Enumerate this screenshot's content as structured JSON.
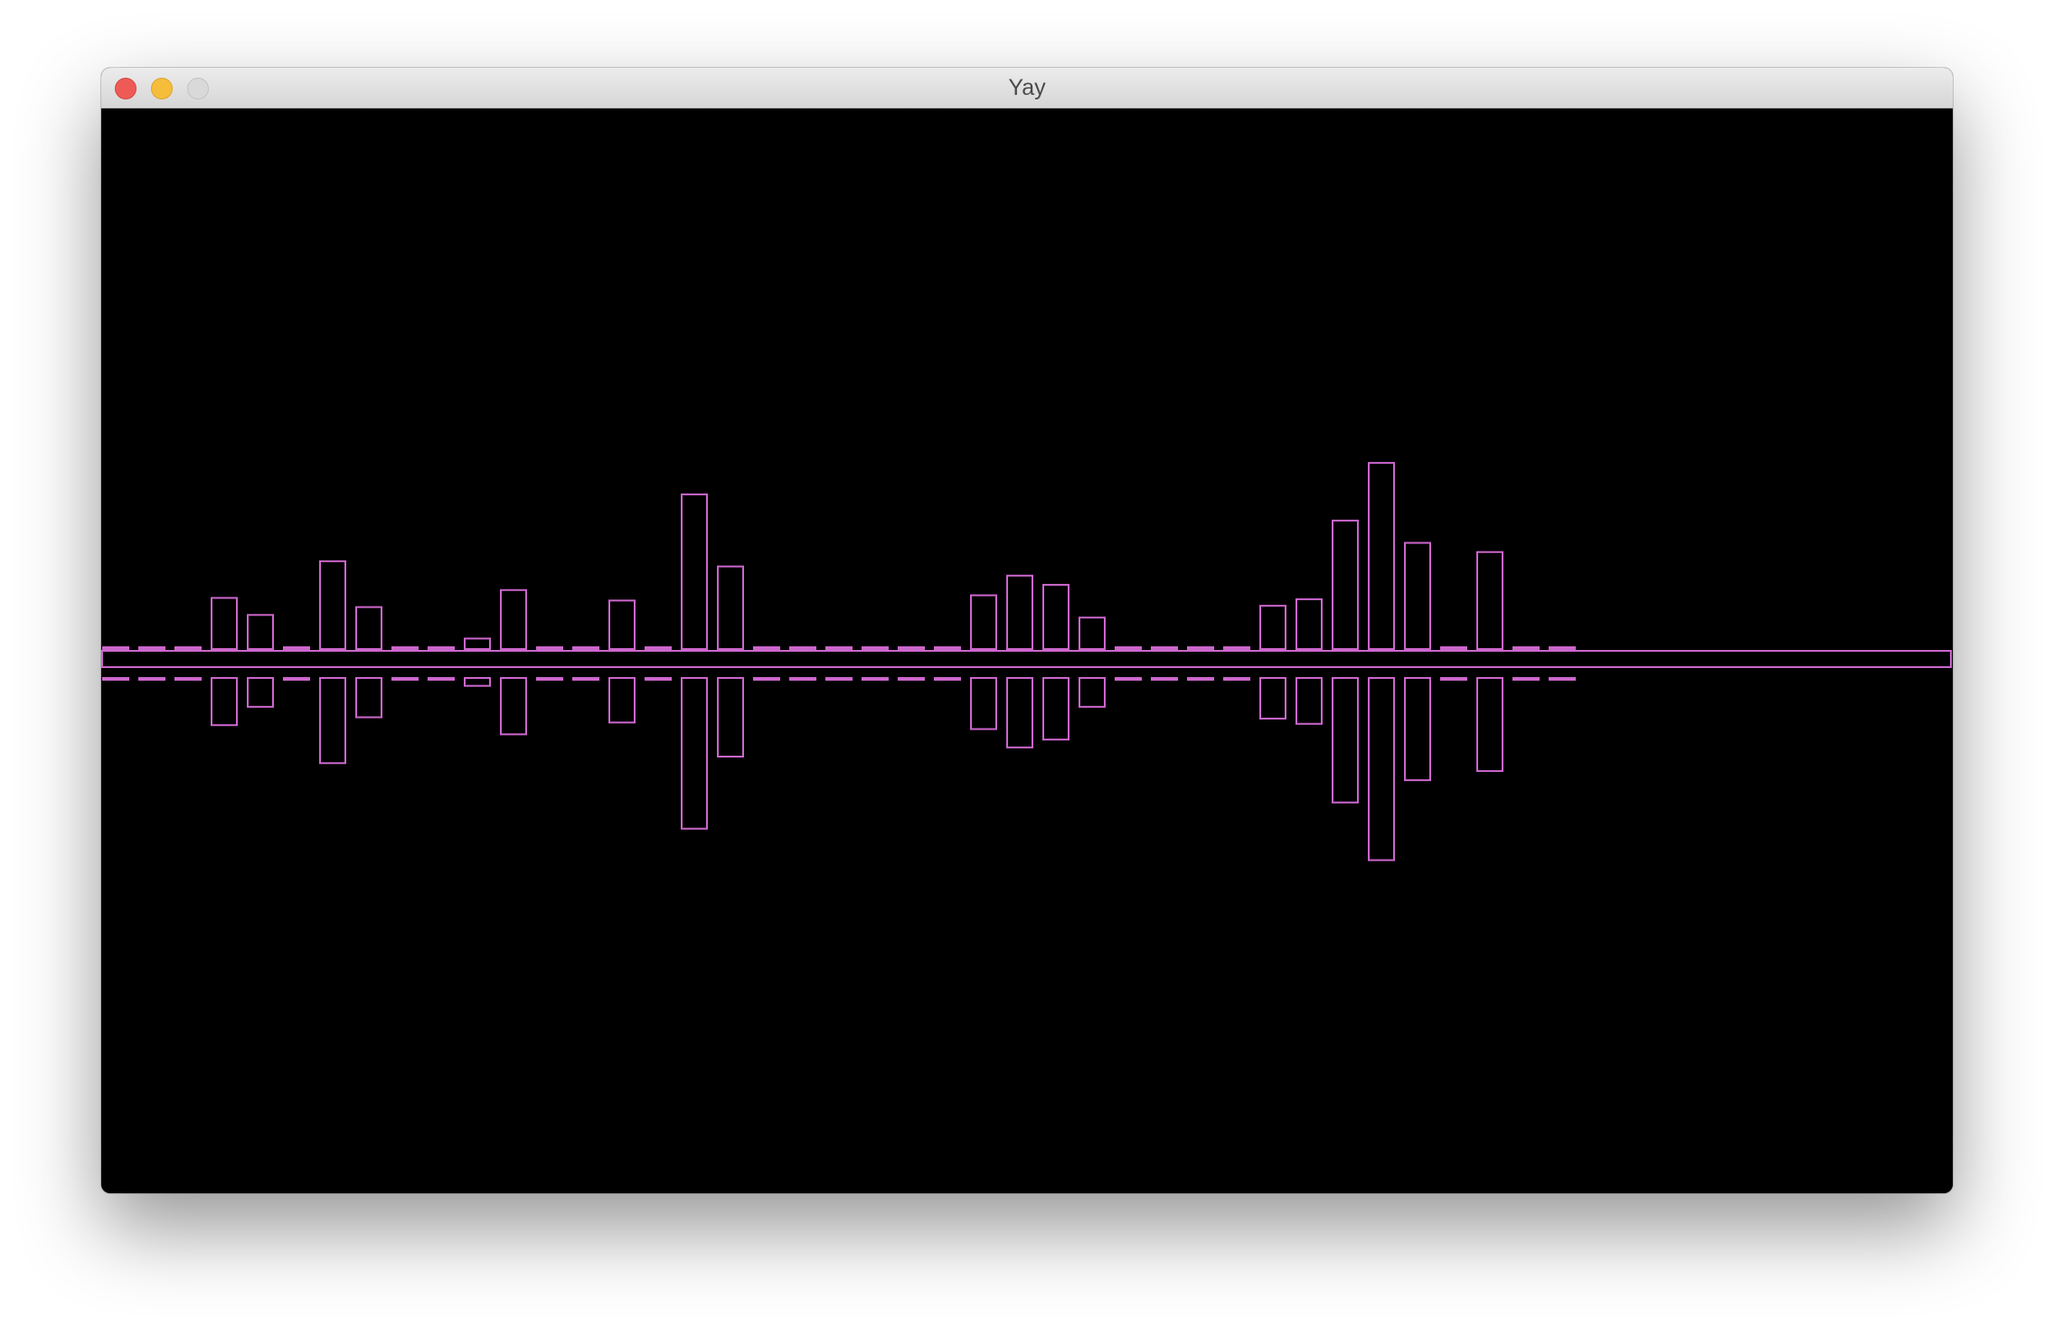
{
  "window": {
    "title": "Yay",
    "controls": {
      "close": "close-button",
      "minimize": "minimize-button",
      "zoom": "zoom-button"
    }
  },
  "visualizer": {
    "stroke_color": "#cc66cc",
    "background_color": "#000000",
    "bar_count": 41,
    "upper_levels": [
      0,
      0,
      0,
      39,
      26,
      0,
      67,
      32,
      0,
      0,
      8,
      45,
      0,
      0,
      37,
      0,
      118,
      63,
      0,
      0,
      0,
      0,
      0,
      0,
      41,
      56,
      49,
      24,
      0,
      0,
      0,
      0,
      33,
      38,
      98,
      142,
      81,
      0,
      74,
      0,
      0
    ],
    "lower_levels": [
      0,
      0,
      0,
      36,
      22,
      0,
      65,
      30,
      0,
      0,
      6,
      43,
      0,
      0,
      34,
      0,
      115,
      60,
      0,
      0,
      0,
      0,
      0,
      0,
      39,
      53,
      47,
      22,
      0,
      0,
      0,
      0,
      31,
      35,
      95,
      139,
      78,
      0,
      71,
      0,
      0
    ]
  }
}
